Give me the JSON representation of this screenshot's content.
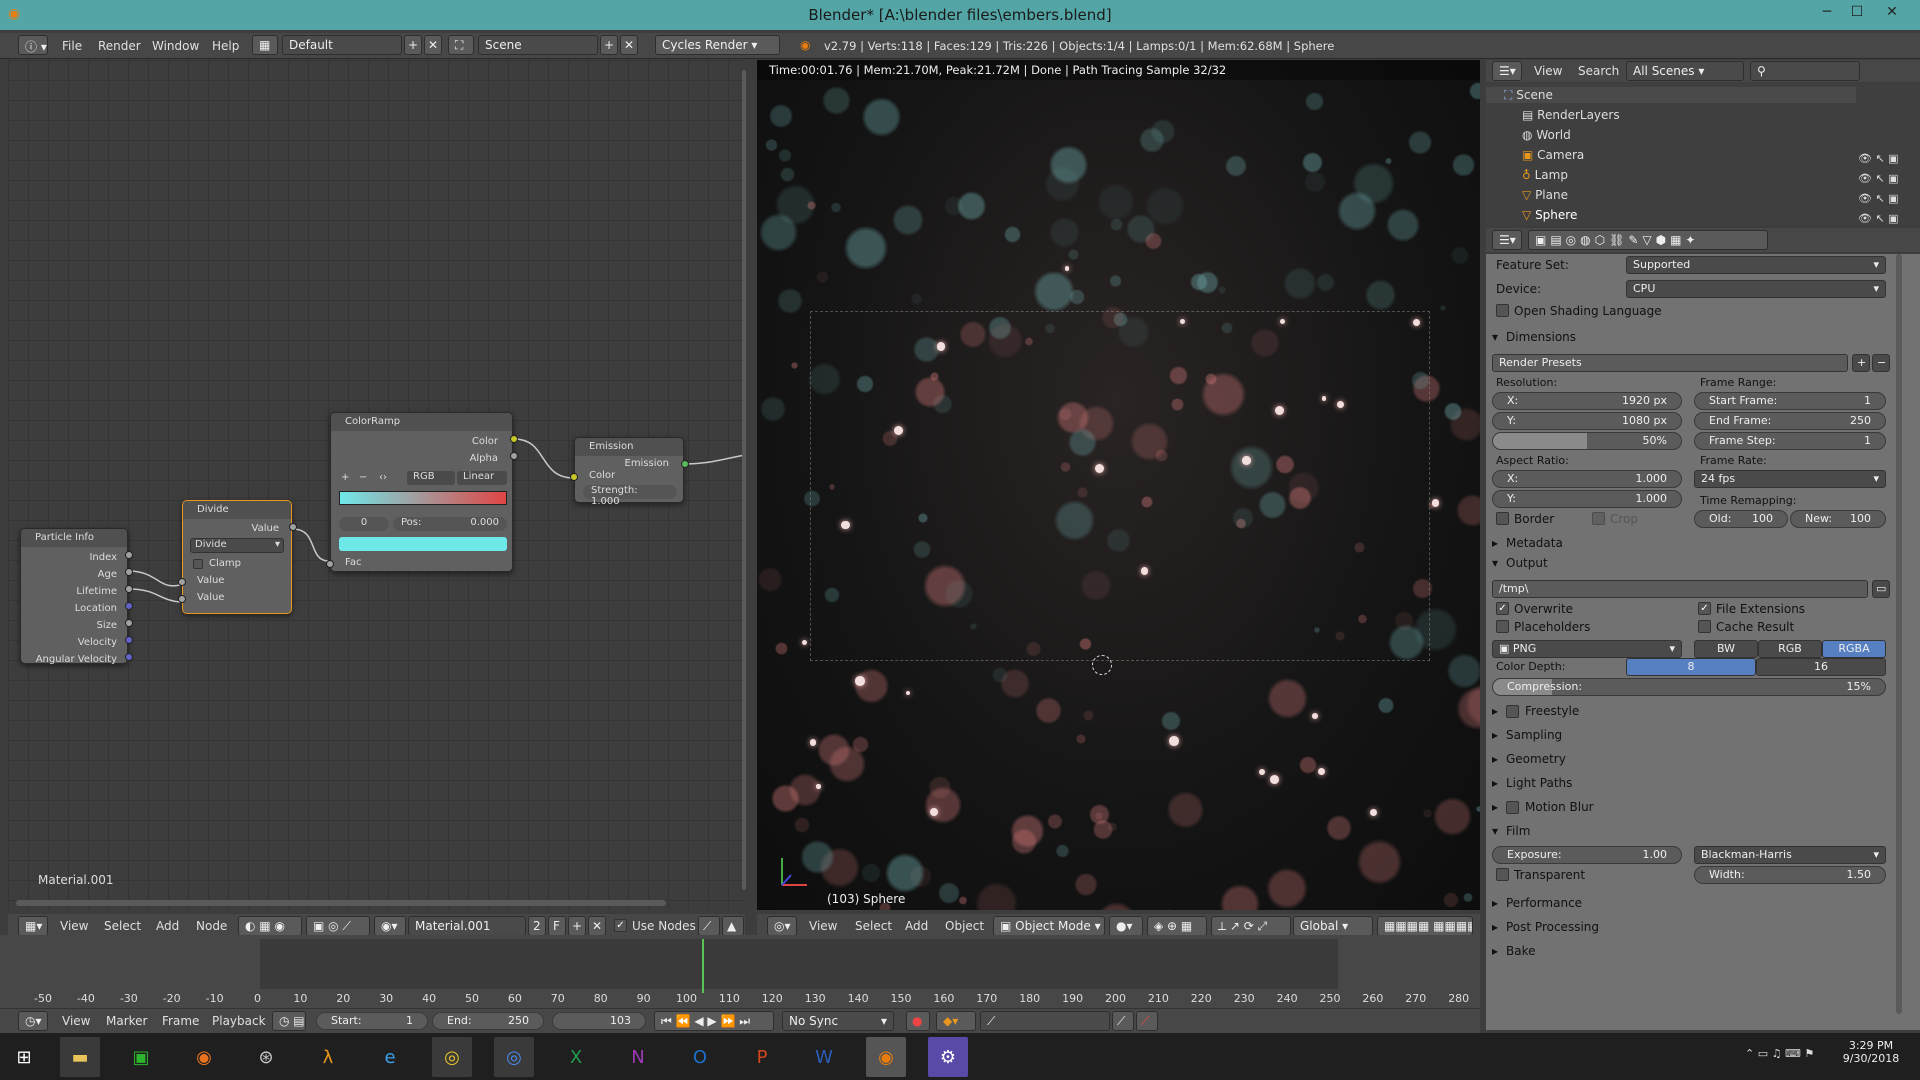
{
  "window": {
    "title": "Blender* [A:\\blender files\\embers.blend]",
    "min_icon": "minimize-icon",
    "max_icon": "maximize-icon",
    "close_icon": "close-icon"
  },
  "info": {
    "menus": [
      "File",
      "Render",
      "Window",
      "Help"
    ],
    "layout": "Default",
    "scene": "Scene",
    "engine": "Cycles Render",
    "stats": "v2.79 | Verts:118 | Faces:129 | Tris:226 | Objects:1/4 | Lamps:0/1 | Mem:62.68M | Sphere"
  },
  "node_editor": {
    "material_label": "Material.001",
    "nodes": {
      "particle_info": {
        "title": "Particle Info",
        "outputs": [
          "Index",
          "Age",
          "Lifetime",
          "Location",
          "Size",
          "Velocity",
          "Angular Velocity"
        ]
      },
      "divide": {
        "title": "Divide",
        "output": "Value",
        "op": "Divide",
        "clamp": "Clamp",
        "in1": "Value",
        "in2": "Value"
      },
      "colorramp": {
        "title": "ColorRamp",
        "out_color": "Color",
        "out_alpha": "Alpha",
        "plus": "+",
        "minus": "−",
        "flip": "‹›",
        "mode": "RGB",
        "interp": "Linear",
        "index": "0",
        "pos_label": "Pos:",
        "pos_value": "0.000",
        "fac": "Fac"
      },
      "emission": {
        "title": "Emission",
        "output": "Emission",
        "in_color": "Color",
        "strength_label": "Strength:",
        "strength_value": "1.000"
      }
    },
    "header": {
      "menus": [
        "View",
        "Select",
        "Add",
        "Node"
      ],
      "material": "Material.001",
      "users": "2",
      "fake": "F",
      "use_nodes": "Use Nodes"
    }
  },
  "viewport": {
    "render_status": "Time:00:01.76 | Mem:21.70M, Peak:21.72M | Done | Path Tracing Sample 32/32",
    "object_label": "(103) Sphere",
    "header": {
      "menus": [
        "View",
        "Select",
        "Add",
        "Object"
      ],
      "mode": "Object Mode",
      "orientation": "Global"
    }
  },
  "outliner": {
    "menus": [
      "View",
      "Search"
    ],
    "filter": "All Scenes",
    "items": [
      "Scene",
      "RenderLayers",
      "World",
      "Camera",
      "Lamp",
      "Plane",
      "Sphere"
    ]
  },
  "properties": {
    "feature_set_label": "Feature Set:",
    "feature_set": "Supported",
    "device_label": "Device:",
    "device": "CPU",
    "osl": "Open Shading Language",
    "dimensions": "Dimensions",
    "render_presets": "Render Presets",
    "resolution_label": "Resolution:",
    "res_x_label": "X:",
    "res_x": "1920 px",
    "res_y_label": "Y:",
    "res_y": "1080 px",
    "res_pct": "50%",
    "frame_range_label": "Frame Range:",
    "start_label": "Start Frame:",
    "start": "1",
    "end_label": "End Frame:",
    "end": "250",
    "step_label": "Frame Step:",
    "step": "1",
    "aspect_label": "Aspect Ratio:",
    "asp_x_label": "X:",
    "asp_x": "1.000",
    "asp_y_label": "Y:",
    "asp_y": "1.000",
    "frame_rate_label": "Frame Rate:",
    "frame_rate": "24 fps",
    "remap_label": "Time Remapping:",
    "old_label": "Old:",
    "old": "100",
    "new_label": "New:",
    "new": "100",
    "border": "Border",
    "crop": "Crop",
    "metadata": "Metadata",
    "output": "Output",
    "path": "/tmp\\",
    "overwrite": "Overwrite",
    "file_ext": "File Extensions",
    "placeholders": "Placeholders",
    "cache_result": "Cache Result",
    "format": "PNG",
    "bw": "BW",
    "rgb": "RGB",
    "rgba": "RGBA",
    "depth_label": "Color Depth:",
    "depth8": "8",
    "depth16": "16",
    "compression_label": "Compression:",
    "compression": "15%",
    "freestyle": "Freestyle",
    "sampling": "Sampling",
    "geometry": "Geometry",
    "light_paths": "Light Paths",
    "motion_blur": "Motion Blur",
    "film": "Film",
    "exposure_label": "Exposure:",
    "exposure": "1.00",
    "filter": "Blackman-Harris",
    "transparent": "Transparent",
    "width_label": "Width:",
    "width": "1.50",
    "performance": "Performance",
    "post_processing": "Post Processing",
    "bake": "Bake"
  },
  "timeline": {
    "ticks": [
      "-50",
      "-40",
      "-30",
      "-20",
      "-10",
      "0",
      "10",
      "20",
      "30",
      "40",
      "50",
      "60",
      "70",
      "80",
      "90",
      "100",
      "110",
      "120",
      "130",
      "140",
      "150",
      "160",
      "170",
      "180",
      "190",
      "200",
      "210",
      "220",
      "230",
      "240",
      "250",
      "260",
      "270",
      "280"
    ],
    "menus": [
      "View",
      "Marker",
      "Frame",
      "Playback"
    ],
    "start_label": "Start:",
    "start": "1",
    "end_label": "End:",
    "end": "250",
    "current": "103",
    "sync": "No Sync"
  },
  "taskbar": {
    "time": "3:29 PM",
    "date": "9/30/2018",
    "apps": [
      "windows-start-icon",
      "file-explorer-icon",
      "store-icon",
      "firefox-icon",
      "steam-icon",
      "half-life-icon",
      "edge-icon",
      "chrome-icon",
      "chrome-alt-icon",
      "excel-icon",
      "onenote-icon",
      "outlook-icon",
      "powerpoint-icon",
      "word-icon",
      "blender-icon",
      "settings-icon"
    ]
  }
}
